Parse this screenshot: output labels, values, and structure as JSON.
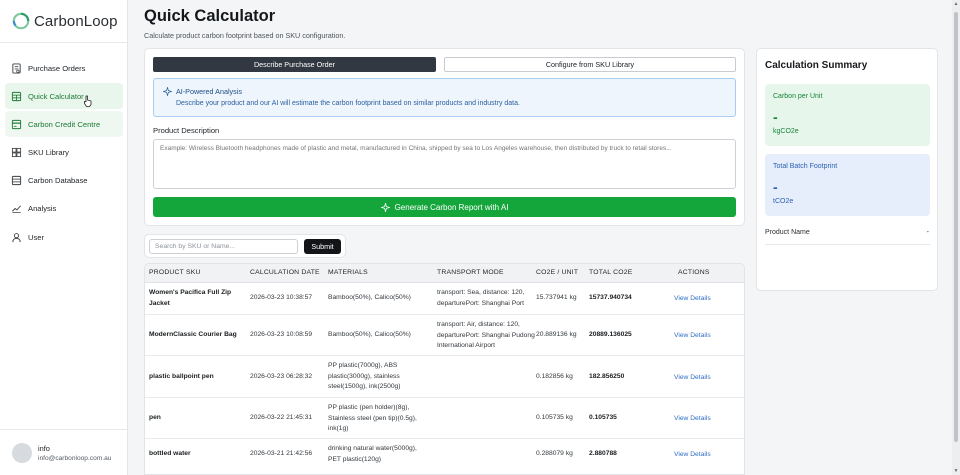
{
  "brand": {
    "name": "CarbonLoop"
  },
  "sidebar": {
    "items": [
      {
        "label": "Purchase Orders",
        "icon": "document-icon"
      },
      {
        "label": "Quick Calculator",
        "icon": "calculator-icon"
      },
      {
        "label": "Carbon Credit Centre",
        "icon": "credit-card-icon"
      },
      {
        "label": "SKU Library",
        "icon": "grid-icon"
      },
      {
        "label": "Carbon Database",
        "icon": "database-icon"
      },
      {
        "label": "Analysis",
        "icon": "trend-chart-icon"
      },
      {
        "label": "User",
        "icon": "user-icon"
      }
    ],
    "active_item": "Quick Calculator"
  },
  "user": {
    "name": "info",
    "email": "info@carbonloop.com.au"
  },
  "header": {
    "title": "Quick Calculator",
    "subtitle": "Calculate product carbon footprint based on SKU configuration."
  },
  "calculator": {
    "tab_describe": "Describe Purchase Order",
    "tab_sku": "Configure from SKU Library",
    "ai_title": "AI-Powered Analysis",
    "ai_desc": "Describe your product and our AI will estimate the carbon footprint based on similar products and industry data.",
    "description_label": "Product Description",
    "description_placeholder": "Example: Wireless Bluetooth headphones made of plastic and metal, manufactured in China, shipped by sea to Los Angeles warehouse, then distributed by truck to retail stores...",
    "generate_label": "Generate Carbon Report with AI"
  },
  "search": {
    "placeholder": "Search by SKU or Name...",
    "submit_label": "Submit"
  },
  "table": {
    "headers": [
      "PRODUCT SKU",
      "CALCULATION DATE",
      "MATERIALS",
      "TRANSPORT MODE",
      "CO2E / UNIT",
      "TOTAL CO2E",
      "ACTIONS"
    ],
    "rows": [
      {
        "sku": "Women's Pacifica Full Zip Jacket",
        "date": "2026-03-23 10:38:57",
        "materials": "Bamboo(50%), Calico(50%)",
        "transport": "transport: Sea, distance: 120, departurePort: Shanghai Port",
        "unit": "15.737941 kg",
        "total": "15737.940734",
        "action": "View Details"
      },
      {
        "sku": "ModernClassic Courier Bag",
        "date": "2026-03-23 10:08:59",
        "materials": "Bamboo(50%), Calico(50%)",
        "transport": "transport: Air, distance: 120, departurePort: Shanghai Pudong International Airport",
        "unit": "20.889136 kg",
        "total": "20889.136025",
        "action": "View Details"
      },
      {
        "sku": "plastic ballpoint pen",
        "date": "2026-03-23 06:28:32",
        "materials": "PP plastic(7000g), ABS plastic(3000g), stainless steel(1500g), ink(2500g)",
        "transport": "",
        "unit": "0.182856 kg",
        "total": "182.856250",
        "action": "View Details"
      },
      {
        "sku": "pen",
        "date": "2026-03-22 21:45:31",
        "materials": "PP plastic (pen holder)(8g), Stainless steel (pen tip)(0.5g), ink(1g)",
        "transport": "",
        "unit": "0.105735 kg",
        "total": "0.105735",
        "action": "View Details"
      },
      {
        "sku": "bottled water",
        "date": "2026-03-21 21:42:56",
        "materials": "drinking natural water(5000g), PET plastic(120g)",
        "transport": "",
        "unit": "0.288079 kg",
        "total": "2.880788",
        "action": "View Details"
      }
    ]
  },
  "summary": {
    "title": "Calculation Summary",
    "per_unit_label": "Carbon per Unit",
    "per_unit_value": "-",
    "per_unit_unit": "kgCO2e",
    "batch_label": "Total Batch Footprint",
    "batch_value": "-",
    "batch_unit": "tCO2e",
    "product_name_label": "Product Name",
    "product_name_value": "-"
  },
  "colors": {
    "accent_green": "#15a63b",
    "nav_active_bg": "#e9f6ec",
    "ai_box_bg": "#eef5fc",
    "metric_green_bg": "#e6f6ea",
    "metric_blue_bg": "#e6eefb",
    "link_blue": "#2f6fc4",
    "dark_button": "#121417"
  }
}
